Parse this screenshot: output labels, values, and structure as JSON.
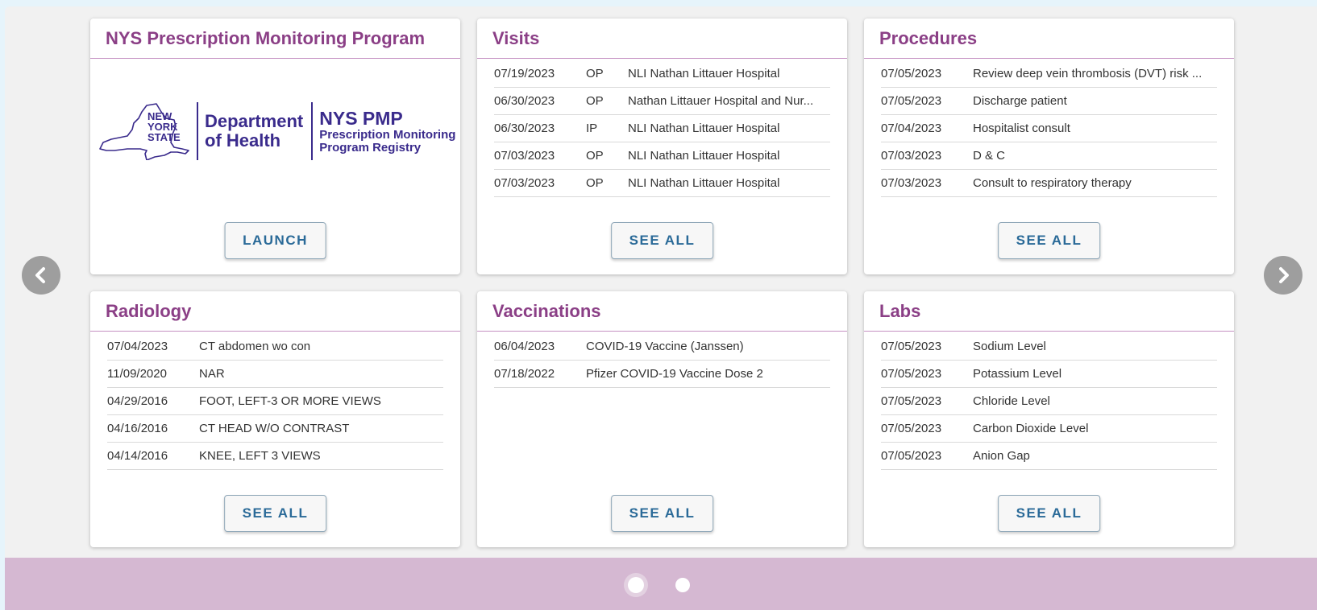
{
  "colors": {
    "accent": "#8b3f86",
    "button_text": "#2a6a98",
    "footer": "#d5b8d2",
    "arrow": "#9e9e9e"
  },
  "pmp": {
    "title": "NYS Prescription Monitoring Program",
    "logo": {
      "state_line1": "NEW",
      "state_line2": "YORK",
      "state_line3": "STATE",
      "dept_line1": "Department",
      "dept_line2": "of Health",
      "pmp_title": "NYS PMP",
      "pmp_sub1": "Prescription Monitoring",
      "pmp_sub2": "Program Registry"
    },
    "button": "LAUNCH"
  },
  "visits": {
    "title": "Visits",
    "rows": [
      {
        "date": "07/19/2023",
        "type": "OP",
        "desc": "NLI Nathan Littauer Hospital"
      },
      {
        "date": "06/30/2023",
        "type": "OP",
        "desc": "Nathan Littauer Hospital and Nur..."
      },
      {
        "date": "06/30/2023",
        "type": "IP",
        "desc": "NLI Nathan Littauer Hospital"
      },
      {
        "date": "07/03/2023",
        "type": "OP",
        "desc": "NLI Nathan Littauer Hospital"
      },
      {
        "date": "07/03/2023",
        "type": "OP",
        "desc": "NLI Nathan Littauer Hospital"
      }
    ],
    "button": "SEE ALL"
  },
  "procedures": {
    "title": "Procedures",
    "rows": [
      {
        "date": "07/05/2023",
        "desc": "Review deep vein thrombosis (DVT) risk ..."
      },
      {
        "date": "07/05/2023",
        "desc": "Discharge patient"
      },
      {
        "date": "07/04/2023",
        "desc": "Hospitalist consult"
      },
      {
        "date": "07/03/2023",
        "desc": "D & C"
      },
      {
        "date": "07/03/2023",
        "desc": "Consult to respiratory therapy"
      }
    ],
    "button": "SEE ALL"
  },
  "radiology": {
    "title": "Radiology",
    "rows": [
      {
        "date": "07/04/2023",
        "desc": "CT abdomen wo con"
      },
      {
        "date": "11/09/2020",
        "desc": "NAR"
      },
      {
        "date": "04/29/2016",
        "desc": "FOOT, LEFT-3 OR MORE VIEWS"
      },
      {
        "date": "04/16/2016",
        "desc": "CT HEAD W/O CONTRAST"
      },
      {
        "date": "04/14/2016",
        "desc": "KNEE, LEFT 3 VIEWS"
      }
    ],
    "button": "SEE ALL"
  },
  "vaccinations": {
    "title": "Vaccinations",
    "rows": [
      {
        "date": "06/04/2023",
        "desc": "COVID-19 Vaccine (Janssen)"
      },
      {
        "date": "07/18/2022",
        "desc": "Pfizer COVID-19 Vaccine Dose 2"
      }
    ],
    "button": "SEE ALL"
  },
  "labs": {
    "title": "Labs",
    "rows": [
      {
        "date": "07/05/2023",
        "desc": "Sodium Level"
      },
      {
        "date": "07/05/2023",
        "desc": "Potassium Level"
      },
      {
        "date": "07/05/2023",
        "desc": "Chloride Level"
      },
      {
        "date": "07/05/2023",
        "desc": "Carbon Dioxide Level"
      },
      {
        "date": "07/05/2023",
        "desc": "Anion Gap"
      }
    ],
    "button": "SEE ALL"
  },
  "navigation": {
    "prev_icon": "chevron-left-icon",
    "next_icon": "chevron-right-icon"
  },
  "pagination": {
    "total_pages": 2,
    "active_page": 1
  }
}
